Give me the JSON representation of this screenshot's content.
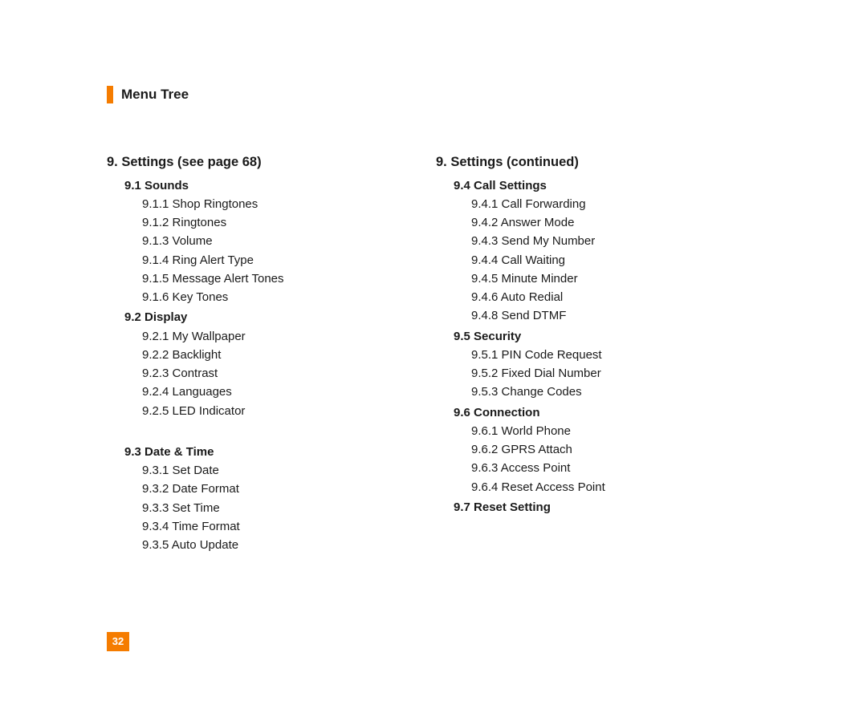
{
  "header": {
    "title": "Menu Tree"
  },
  "page_number": "32",
  "left": {
    "heading": "9.  Settings (see page 68)",
    "groups": [
      {
        "title": "9.1 Sounds",
        "class": "first",
        "items": [
          "9.1.1 Shop Ringtones",
          "9.1.2 Ringtones",
          "9.1.3 Volume",
          "9.1.4 Ring Alert Type",
          "9.1.5 Message Alert Tones",
          "9.1.6 Key Tones"
        ]
      },
      {
        "title": "9.2 Display",
        "class": "group",
        "items": [
          "9.2.1 My Wallpaper",
          "9.2.2 Backlight",
          "9.2.3 Contrast",
          "9.2.4 Languages",
          "9.2.5 LED Indicator"
        ]
      },
      {
        "title": "9.3 Date & Time",
        "class": "gap",
        "items": [
          "9.3.1 Set Date",
          "9.3.2 Date Format",
          "9.3.3 Set Time",
          "9.3.4 Time Format",
          "9.3.5 Auto Update"
        ]
      }
    ]
  },
  "right": {
    "heading": "9.  Settings (continued)",
    "groups": [
      {
        "title": "9.4 Call Settings",
        "class": "first",
        "items": [
          "9.4.1 Call Forwarding",
          "9.4.2 Answer Mode",
          "9.4.3 Send My Number",
          "9.4.4 Call Waiting",
          "9.4.5 Minute Minder",
          "9.4.6 Auto Redial",
          "9.4.8 Send DTMF"
        ]
      },
      {
        "title": "9.5 Security",
        "class": "group",
        "items": [
          "9.5.1 PIN Code Request",
          "9.5.2 Fixed Dial Number",
          "9.5.3 Change Codes"
        ]
      },
      {
        "title": "9.6 Connection",
        "class": "group",
        "items": [
          "9.6.1 World Phone",
          "9.6.2 GPRS Attach",
          "9.6.3 Access Point",
          "9.6.4 Reset Access Point"
        ]
      },
      {
        "title": "9.7 Reset Setting",
        "class": "group",
        "items": []
      }
    ]
  }
}
